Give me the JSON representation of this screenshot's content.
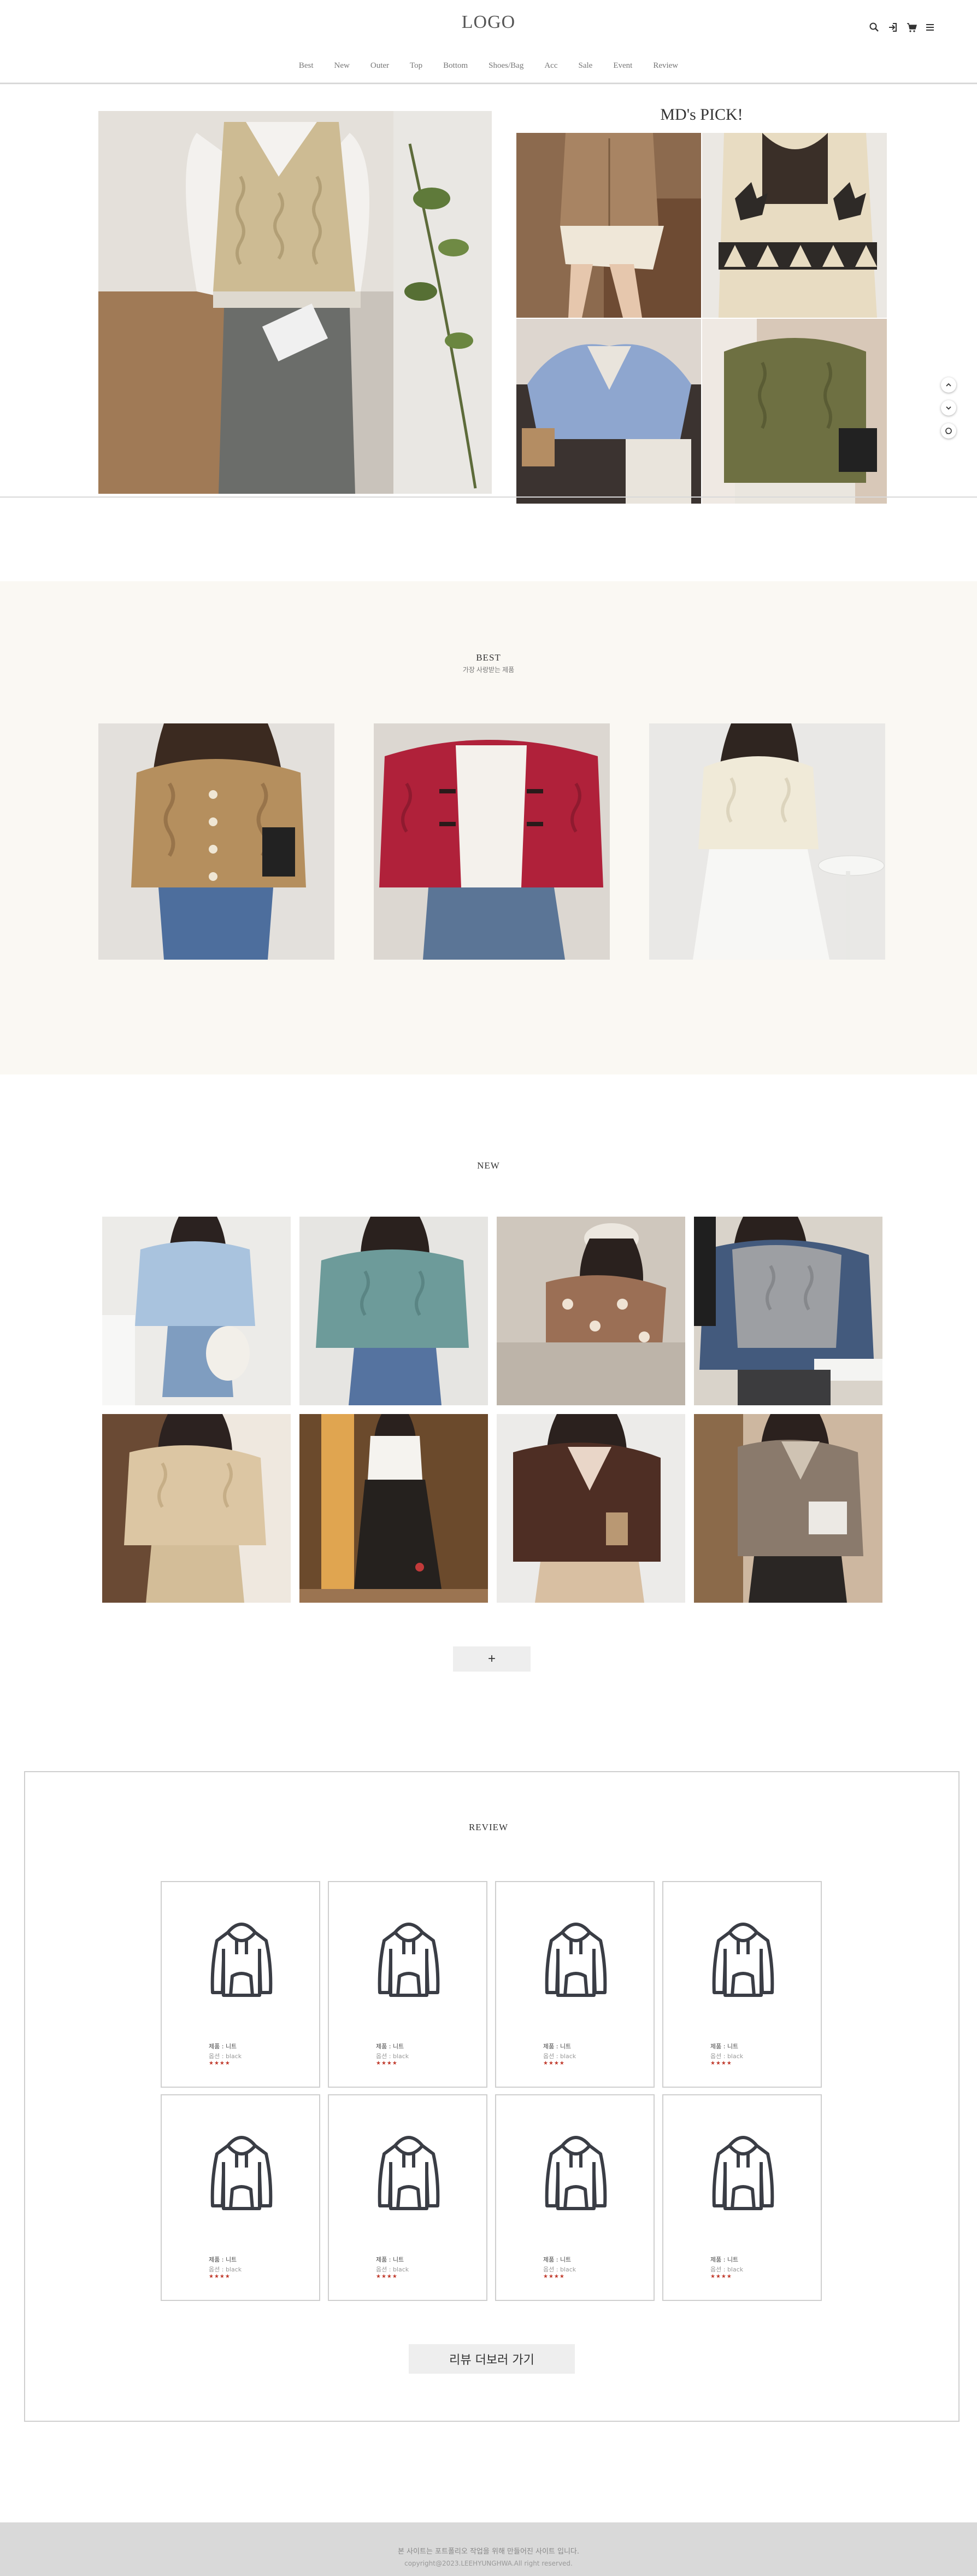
{
  "header": {
    "logo": "LOGO",
    "icons": [
      "search-icon",
      "login-icon",
      "cart-icon",
      "menu-icon"
    ],
    "nav": [
      "Best",
      "New",
      "Outer",
      "Top",
      "Bottom",
      "Shoes/Bag",
      "Acc",
      "Sale",
      "Event",
      "Review"
    ]
  },
  "hero": {
    "main_photo": "woman in cable-knit vest over white shirt, grey shorts",
    "mds_pick_title": "MD's PICK!",
    "picks": [
      {
        "photo": "tan cardigan, white skirt"
      },
      {
        "photo": "cream nordic reindeer cardigan"
      },
      {
        "photo": "blue v-neck cardigan"
      },
      {
        "photo": "olive cable-knit cardigan"
      }
    ]
  },
  "side_buttons": [
    "arrow-up-icon",
    "arrow-down-icon",
    "chat-icon"
  ],
  "best": {
    "title": "BEST",
    "subtitle": "가장 사랑받는 제품",
    "items": [
      {
        "photo": "tan cable knit cardigan with denim skirt"
      },
      {
        "photo": "red toggle cardigan with denim skirt"
      },
      {
        "photo": "cream cable knit with white skirt"
      }
    ]
  },
  "new": {
    "title": "NEW",
    "items": [
      {
        "photo": "light blue cropped sweater, denim skirt"
      },
      {
        "photo": "teal cable-knit sweater, jeans"
      },
      {
        "photo": "patterned brown sweater, beret"
      },
      {
        "photo": "grey vest over denim shirt"
      },
      {
        "photo": "beige cable-knit sweater and skirt"
      },
      {
        "photo": "black corduroy long skirt"
      },
      {
        "photo": "brown v-neck sweater"
      },
      {
        "photo": "taupe v-neck sweater"
      }
    ],
    "more_label": "+"
  },
  "review": {
    "title": "REVIEW",
    "cards": [
      {
        "name": "제품 : 니트",
        "option": "옵션 : black",
        "stars": "★★★★"
      },
      {
        "name": "제품 : 니트",
        "option": "옵션 : black",
        "stars": "★★★★"
      },
      {
        "name": "제품 : 니트",
        "option": "옵션 : black",
        "stars": "★★★★"
      },
      {
        "name": "제품 : 니트",
        "option": "옵션 : black",
        "stars": "★★★★"
      },
      {
        "name": "제품 : 니트",
        "option": "옵션 : black",
        "stars": "★★★★"
      },
      {
        "name": "제품 : 니트",
        "option": "옵션 : black",
        "stars": "★★★★"
      },
      {
        "name": "제품 : 니트",
        "option": "옵션 : black",
        "stars": "★★★★"
      },
      {
        "name": "제품 : 니트",
        "option": "옵션 : black",
        "stars": "★★★★"
      }
    ],
    "more_label": "리뷰 더보러 가기"
  },
  "footer": {
    "line1": "본 사이트는 포트폴리오 작업을 위해 만들어진 사이트 입니다.",
    "line2": "copyright@2023.LEEHYUNGHWA.All right reserved."
  },
  "colors": {
    "best_background": "#faf8f3",
    "footer_background": "#d9d9d9",
    "button_background": "#eeeeee",
    "star": "#c0392b"
  }
}
